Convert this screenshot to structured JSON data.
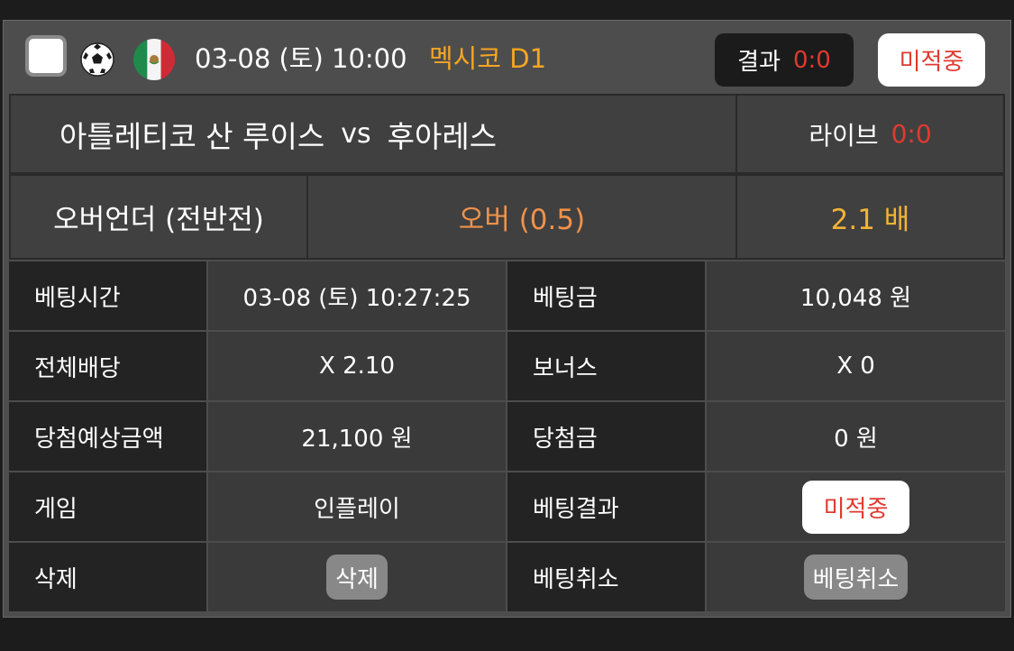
{
  "header": {
    "date": "03-08 (토) 10:00",
    "league": "멕시코 D1",
    "result_label": "결과",
    "result_score": "0:0",
    "status": "미적중"
  },
  "match": {
    "home": "아틀레티코 산 루이스",
    "vs": "vs",
    "away": "후아레스",
    "live_label": "라이브",
    "live_score": "0:0"
  },
  "bet": {
    "market": "오버언더 (전반전)",
    "pick": "오버 (0.5)",
    "odds": "2.1 배"
  },
  "details": {
    "bet_time_label": "베팅시간",
    "bet_time": "03-08 (토) 10:27:25",
    "bet_amount_label": "베팅금",
    "bet_amount": "10,048 원",
    "total_odds_label": "전체배당",
    "total_odds": "X 2.10",
    "bonus_label": "보너스",
    "bonus": "X 0",
    "expected_label": "당첨예상금액",
    "expected": "21,100 원",
    "winnings_label": "당첨금",
    "winnings": "0 원",
    "game_label": "게임",
    "game": "인플레이",
    "bet_result_label": "베팅결과",
    "bet_result": "미적중",
    "delete_label": "삭제",
    "delete_button": "삭제",
    "cancel_label": "베팅취소",
    "cancel_button": "베팅취소"
  },
  "icons": {
    "sport": "soccer-ball-icon",
    "country": "mexico-flag-icon"
  },
  "colors": {
    "accent_orange": "#f5a623",
    "loss_red": "#e03a2f",
    "pick_orange": "#f0924a",
    "odds_yellow": "#f5b335"
  }
}
